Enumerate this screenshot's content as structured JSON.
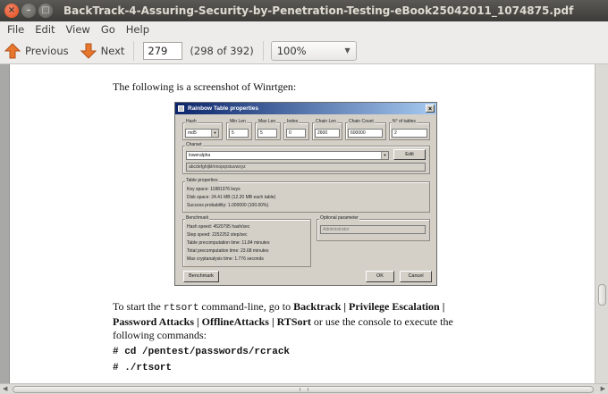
{
  "window": {
    "title": "BackTrack-4-Assuring-Security-by-Penetration-Testing-eBook25042011_1074875.pdf",
    "close_glyph": "×",
    "minimize_glyph": "–",
    "maximize_glyph": "□"
  },
  "menu": [
    "File",
    "Edit",
    "View",
    "Go",
    "Help"
  ],
  "toolbar": {
    "previous_label": "Previous",
    "next_label": "Next",
    "page_value": "279",
    "page_of": "(298 of 392)",
    "zoom_value": "100%",
    "zoom_arrow": "▼"
  },
  "document": {
    "intro": "The following is a screenshot of Winrtgen:",
    "para_parts": {
      "p1": "To start the ",
      "code": "rtsort",
      "p2": " command-line, go to ",
      "bold1": "Backtrack | Privilege Escalation |",
      "bold2": "Password Attacks | OfflineAttacks | RTSort",
      "p3": " or use the console to execute the",
      "p4": "following commands:"
    },
    "commands": [
      "# cd /pentest/passwords/rcrack",
      "# ./rtsort"
    ]
  },
  "screenshot": {
    "title": "Rainbow Table properties",
    "close_glyph": "×",
    "hash_label": "Hash",
    "hash_value": "md5",
    "min_len_label": "Min Len",
    "min_len": "5",
    "max_len_label": "Max Len",
    "max_len": "5",
    "index_label": "Index",
    "index": "0",
    "chain_len_label": "Chain Len",
    "chain_len": "2600",
    "chain_count_label": "Chain Count",
    "chain_count": "600000",
    "tables_label": "N° of tables",
    "tables": "2",
    "charset_label": "Charset",
    "charset_value": "loweralpha",
    "edit_label": "Edit",
    "charset_chars": "abcdefghijklmnopqrstuvwxyz",
    "table_props_label": "Table properties",
    "key_space": "Key space: 11881376 keys",
    "disk_space": "Disk space: 24.41 MB (12.20 MB each table)",
    "success": "Success probability: 1.000000 (100.00%)",
    "benchmark_label": "Benchmark",
    "hash_speed": "Hash speed: 4520795 hash/sec",
    "step_speed": "Step speed: 2252252 step/sec",
    "table_precomp": "Table precomputation time: 11.84 minutes",
    "total_precomp": "Total precomputation time: 23.68 minutes",
    "max_crypt": "Max cryptanalysis time: 1.776 seconds",
    "optional_label": "Optional parameter",
    "optional_value": "Administrator",
    "benchmark_btn": "Benchmark",
    "ok_btn": "OK",
    "cancel_btn": "Cancel"
  },
  "colors": {
    "previous_arrow": "#e8772e",
    "next_arrow": "#e8772e"
  }
}
